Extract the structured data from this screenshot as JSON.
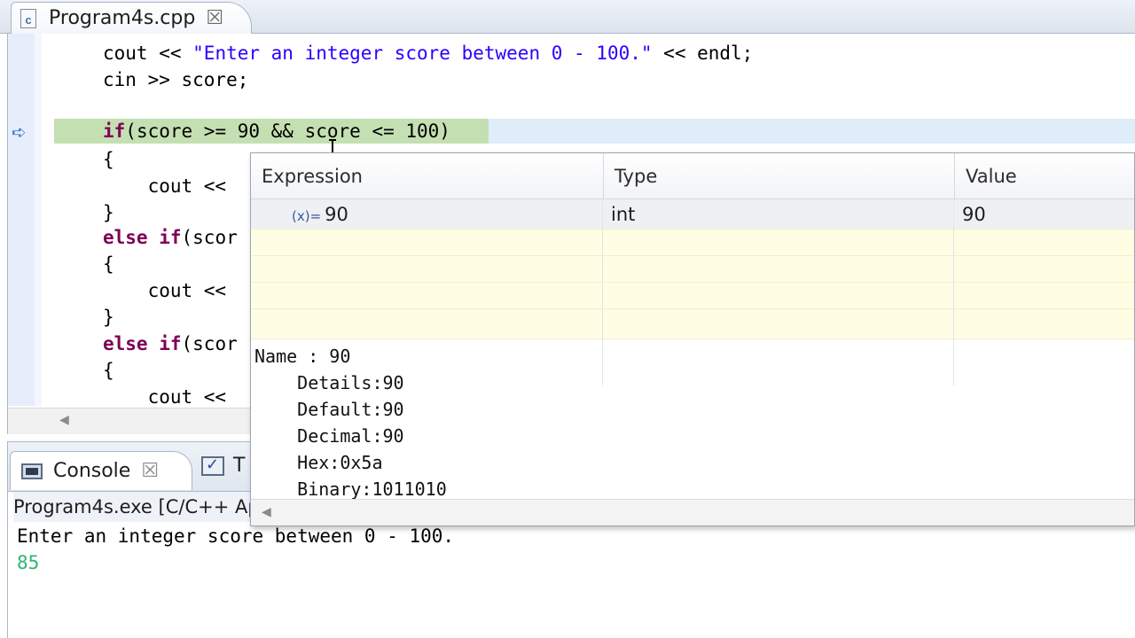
{
  "editor": {
    "tab_label": "Program4s.cpp",
    "tab_close": "☒",
    "file_icon": "c",
    "lines": {
      "l1_a": "cout << ",
      "l1_str": "\"Enter an integer score between 0 - 100.\"",
      "l1_b": " << endl;",
      "l2": "cin >> score;",
      "l4_kw": "if",
      "l4_rest": "(score >= 90 && score <= 100)",
      "l5": "{",
      "l6": "    cout << ",
      "l7": "}",
      "l8_kw": "else if",
      "l8_rest": "(scor",
      "l9": "{",
      "l10": "    cout << ",
      "l11": "}",
      "l12_kw": "else if",
      "l12_rest": "(scor",
      "l13": "{",
      "l14": "    cout << "
    }
  },
  "hover": {
    "columns": {
      "expression": "Expression",
      "type": "Type",
      "value": "Value"
    },
    "row": {
      "icon": "(x)=",
      "expression": "90",
      "type": "int",
      "value": "90"
    },
    "details": {
      "name": "Name : 90",
      "details": "    Details:90",
      "default": "    Default:90",
      "decimal": "    Decimal:90",
      "hex": "    Hex:0x5a",
      "binary": "    Binary:1011010"
    }
  },
  "console": {
    "tab_label": "Console",
    "tab_close": "☒",
    "tasks_label": "T",
    "process": "Program4s.exe [C/C++ Ap",
    "output_line": "Enter an integer score between 0 - 100.",
    "input_line": "85"
  },
  "colors": {
    "keyword": "#7f0055",
    "string": "#2a00ff",
    "current_line": "#dfecf9",
    "breakpoint_line": "#c4e0b3",
    "console_input": "#2bb673"
  },
  "icons": {
    "file": "cpp-file-icon",
    "instruction_pointer": "arrow-icon",
    "variable": "variable-icon",
    "console": "console-icon",
    "tasks": "tasks-icon"
  }
}
